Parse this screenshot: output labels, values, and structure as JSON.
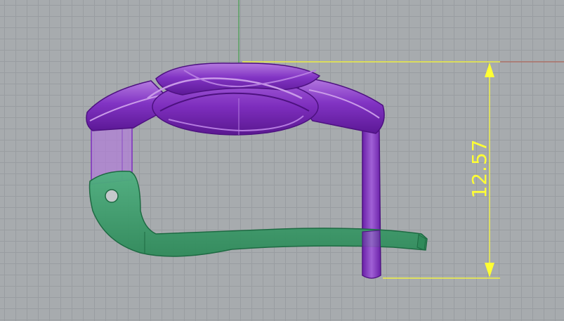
{
  "viewport": {
    "background": "#a7abae",
    "grid_color": "#999da1",
    "axis_x_color": "#b55a4a",
    "axis_y_color": "#2f9e3a"
  },
  "model": {
    "knot_color": "#7d2dbd",
    "shank_color": "#3c9a6a",
    "pin_color": "#8a3dcc"
  },
  "dimension": {
    "value": "12.57",
    "color": "#ffff33"
  }
}
